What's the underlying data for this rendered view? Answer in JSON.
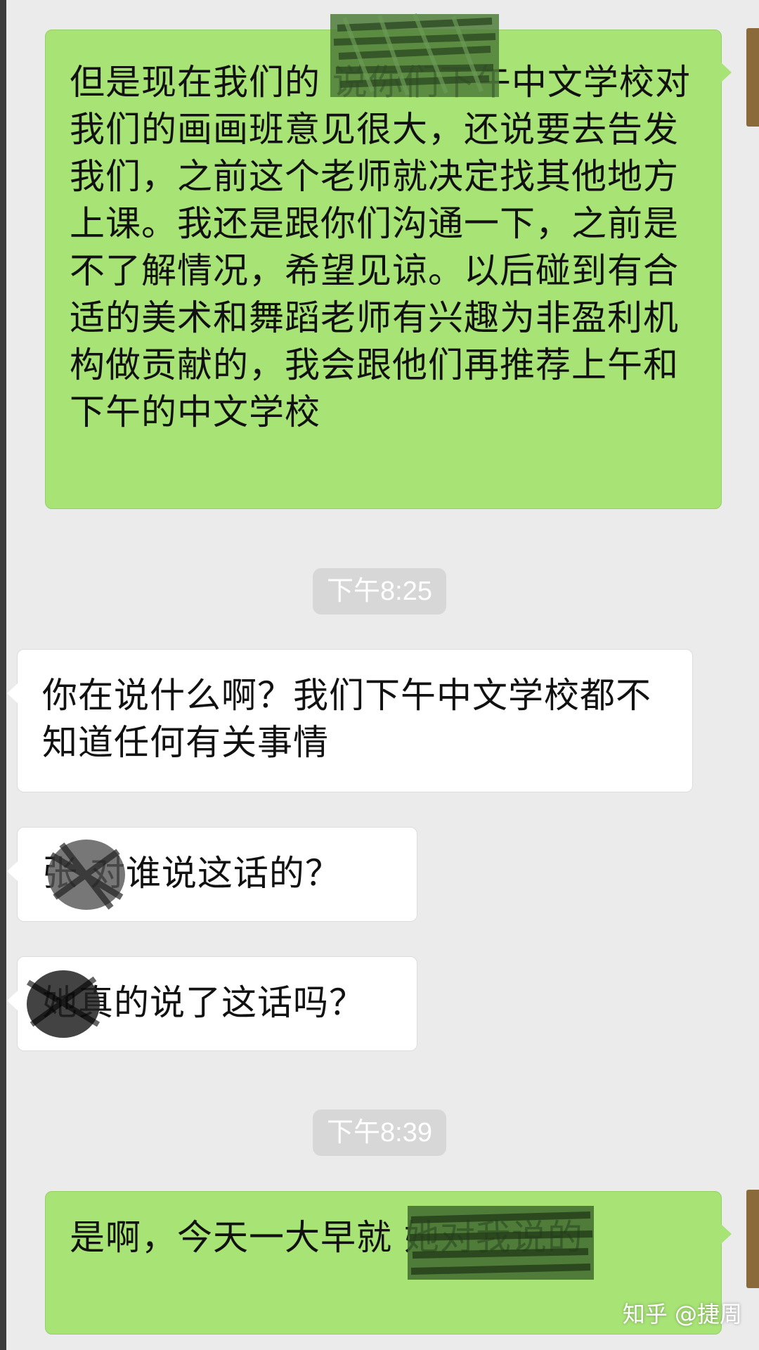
{
  "messages": [
    {
      "side": "sent",
      "text": "但是现在我们的 说你们下午中文学校对我们的画画班意见很大，还说要去告发我们，之前这个老师就决定找其他地方上课。我还是跟你们沟通一下，之前是不了解情况，希望见谅。以后碰到有合适的美术和舞蹈老师有兴趣为非盈利机构做贡献的，我会跟他们再推荐上午和下午的中文学校"
    },
    {
      "side": "timestamp",
      "text": "下午8:25"
    },
    {
      "side": "recv",
      "text": "你在说什么啊？我们下午中文学校都不知道任何有关事情"
    },
    {
      "side": "recv",
      "text": "张 对谁说这话的？"
    },
    {
      "side": "recv",
      "text": "她真的说了这话吗？"
    },
    {
      "side": "timestamp",
      "text": "下午8:39"
    },
    {
      "side": "sent",
      "text": "是啊，今天一大早就 她对我说的"
    }
  ],
  "watermark": "知乎 @捷周",
  "colors": {
    "background": "#ebebeb",
    "sent_bubble": "#a8e376",
    "recv_bubble": "#ffffff",
    "timestamp_bg": "#d7d7d7"
  }
}
